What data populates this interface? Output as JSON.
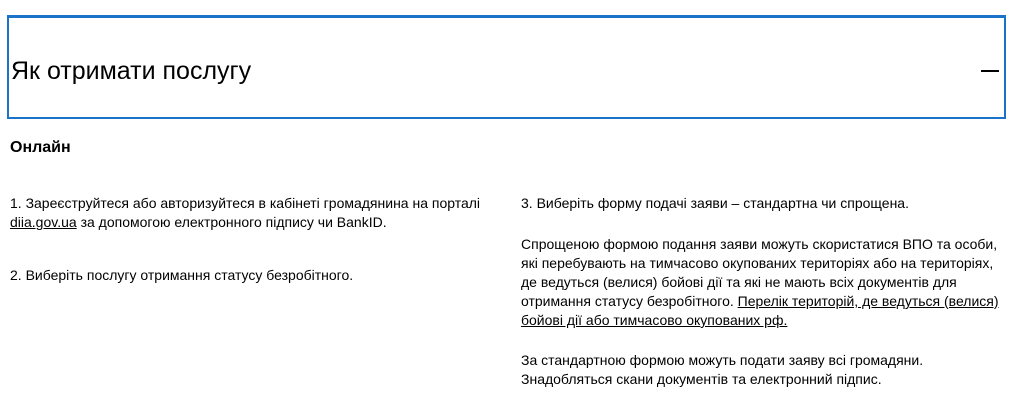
{
  "accordion": {
    "title": "Як отримати послугу",
    "collapse_symbol": ""
  },
  "section": {
    "heading": "Онлайн"
  },
  "left_column": {
    "step1_before": "1. Зареєструйтеся або авторизуйтеся в кабінеті громадянина на порталі ",
    "step1_link": "diia.gov.ua",
    "step1_after": " за допомогою електронного підпису чи BankID.",
    "step2": "2. Виберіть послугу отримання статусу безробітного."
  },
  "right_column": {
    "step3": "3. Виберіть форму подачі заяви – стандартна чи спрощена.",
    "simplified_text": "Спрощеною формою подання заяви можуть скористатися ВПО та особи, які перебувають на тимчасово окупованих територіях або на територіях, де ведуться (велися) бойові дії та які не мають всіх документів для отримання статусу безробітного. ",
    "territories_link": "Перелік територій, де ведуться (велися) бойові дії або тимчасово окупованих рф.",
    "standard_text": "За стандартною формою можуть подати заяву всі громадяни. Знадобляться скани документів та електронний підпис."
  },
  "colors": {
    "accordion_border": "#1a73c8",
    "text": "#000000",
    "background": "#ffffff"
  }
}
